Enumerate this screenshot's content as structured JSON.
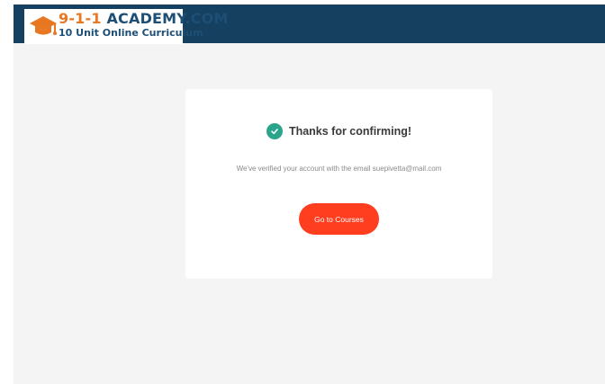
{
  "header": {
    "logo": {
      "title_number": "9-1-1",
      "title_rest": " ACADEMY.COM",
      "subtitle": "10 Unit Online Curriculum",
      "icon": "graduation-cap-icon",
      "accent_color": "#e87722",
      "brand_color": "#1d4f76"
    },
    "bar_color": "#15405f"
  },
  "confirmation": {
    "icon": "check-circle-icon",
    "title": "Thanks for confirming!",
    "message": "We've verified your account with the email suepivetta@mail.com",
    "button_label": "Go to Courses",
    "button_color": "#ff3d1f",
    "check_color": "#2aa58b"
  }
}
